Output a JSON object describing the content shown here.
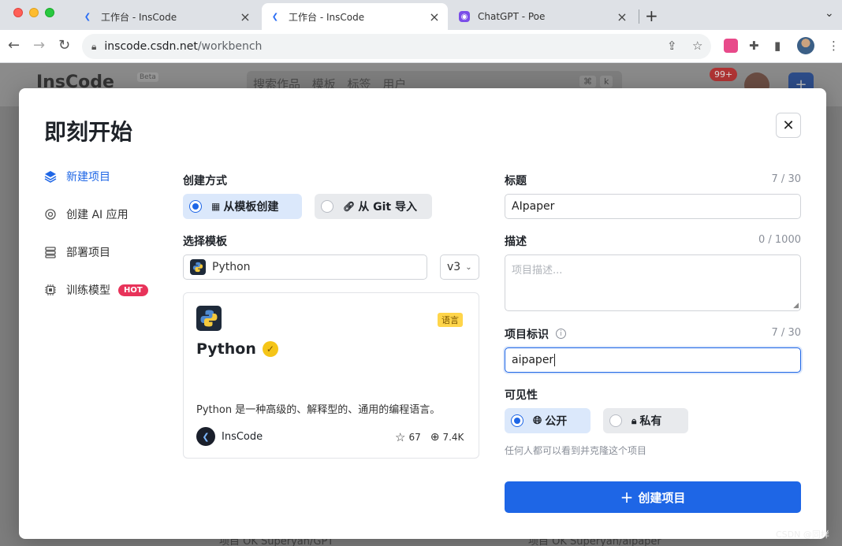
{
  "browser": {
    "tabs": [
      {
        "title": "工作台 - InsCode",
        "active": false
      },
      {
        "title": "工作台 - InsCode",
        "active": true
      },
      {
        "title": "ChatGPT - Poe",
        "active": false
      }
    ],
    "url_host": "inscode.csdn.net",
    "url_path": "/workbench"
  },
  "background": {
    "logo": "InsCode",
    "beta": "Beta",
    "search_text": "搜索作品 模板 标签 用户",
    "kbd_cmd": "⌘",
    "kbd_k": "k",
    "notification_count": "99+",
    "footer_left": "项目 OK    Superyan/GPT",
    "footer_right": "项目 OK    Superyan/aipaper"
  },
  "modal": {
    "title": "即刻开始",
    "nav": [
      {
        "label": "新建项目",
        "active": true
      },
      {
        "label": "创建 AI 应用",
        "active": false
      },
      {
        "label": "部署项目",
        "active": false
      },
      {
        "label": "训练模型",
        "active": false,
        "badge": "HOT"
      }
    ],
    "create_method": {
      "label": "创建方式",
      "options": [
        {
          "label": "从模板创建",
          "selected": true
        },
        {
          "label": "从 Git 导入",
          "selected": false
        }
      ]
    },
    "template": {
      "label": "选择模板",
      "selected": "Python",
      "version": "v3"
    },
    "card": {
      "tag": "语言",
      "title": "Python",
      "description": "Python 是一种高级的、解释型的、通用的编程语言。",
      "author": "InsCode",
      "stars": "67",
      "forks": "7.4K"
    },
    "form": {
      "title_label": "标题",
      "title_count": "7 / 30",
      "title_value": "AIpaper",
      "desc_label": "描述",
      "desc_count": "0 / 1000",
      "desc_placeholder": "项目描述...",
      "id_label": "项目标识",
      "id_count": "7 / 30",
      "id_value": "aipaper",
      "visibility_label": "可见性",
      "visibility_options": [
        {
          "label": "公开",
          "selected": true
        },
        {
          "label": "私有",
          "selected": false
        }
      ],
      "visibility_hint": "任何人都可以看到并克隆这个项目",
      "submit_label": "创建项目"
    }
  },
  "watermark": "CSDN @同样"
}
